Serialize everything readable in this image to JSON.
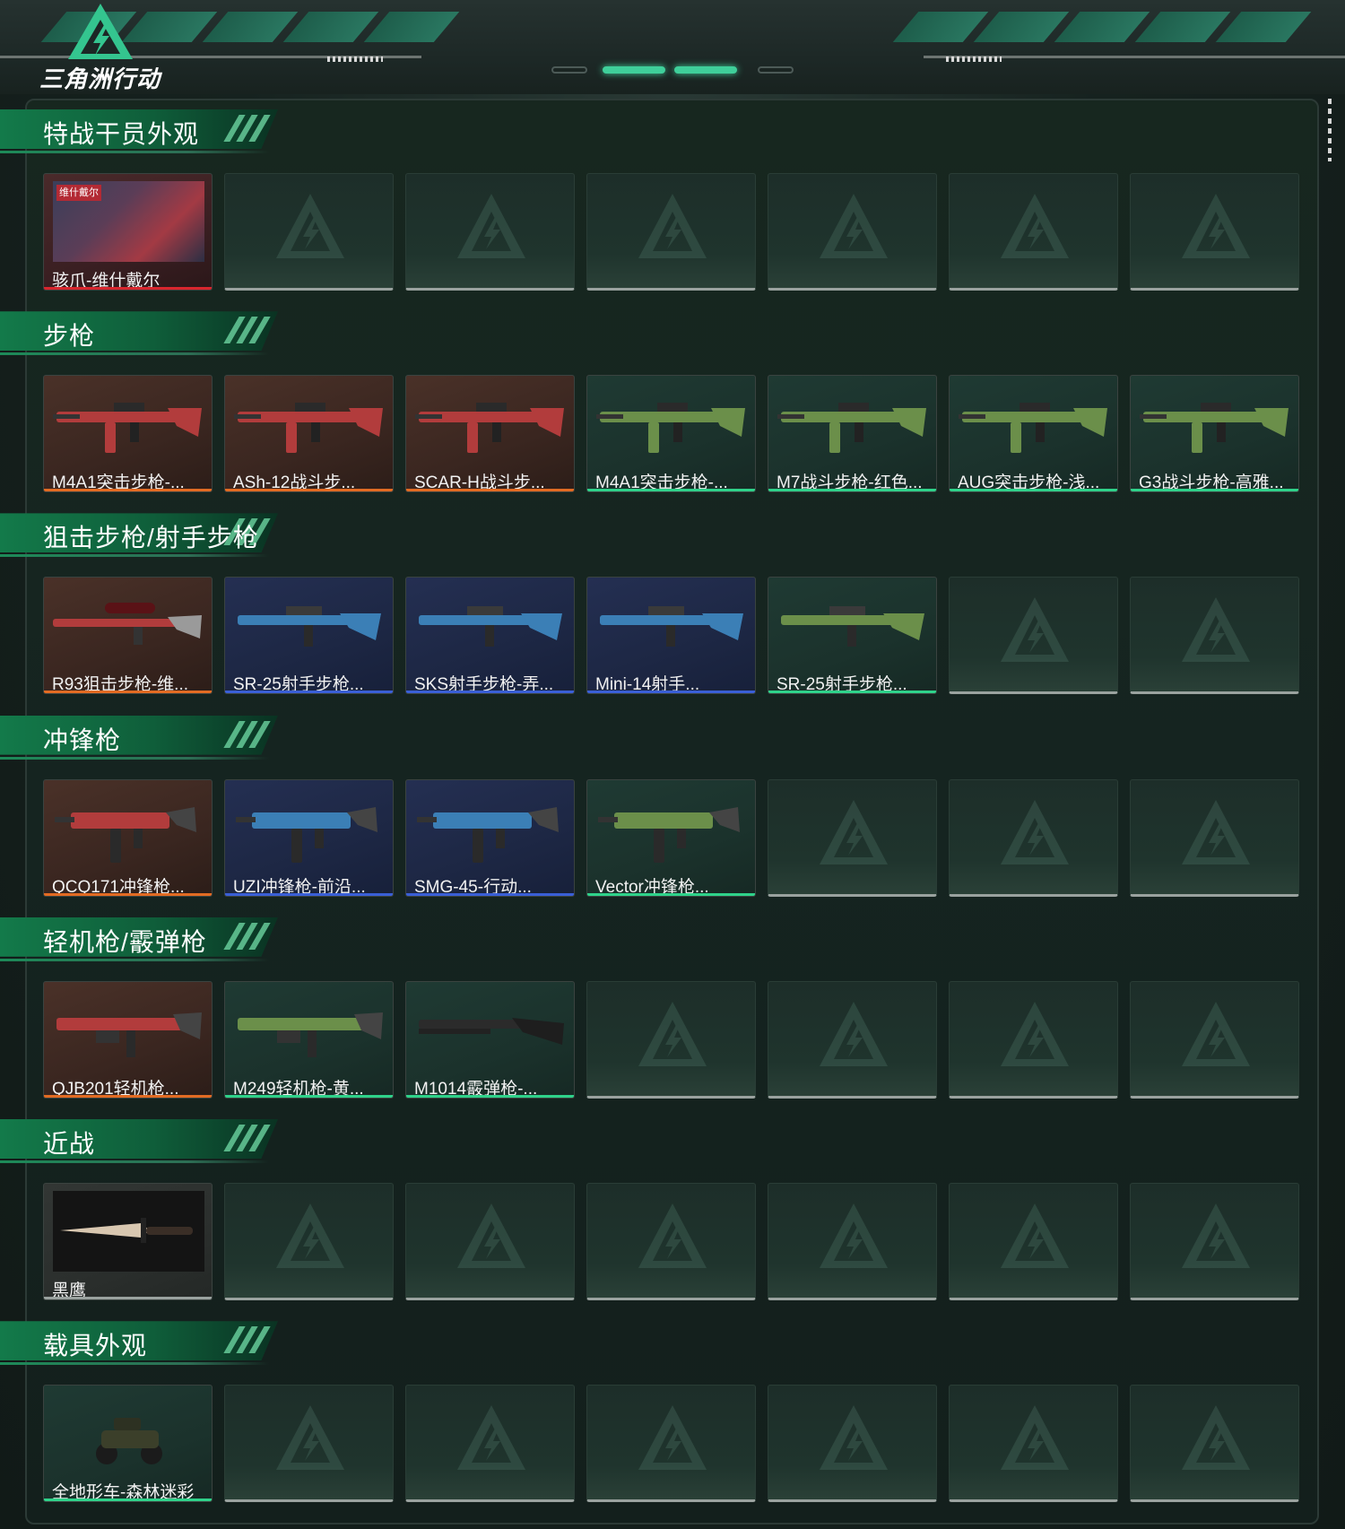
{
  "header": {
    "logo_text": "三角洲行动",
    "logo_icon": "delta-triangle-logo-icon"
  },
  "colors": {
    "accent": "#3fcf9a",
    "section_green": "#137a4a",
    "rarity_orange": "#e26b23",
    "rarity_blue": "#3a5fd6",
    "rarity_green": "#2fd28a",
    "rarity_red": "#d8262e",
    "empty_bar": "#9aa29f"
  },
  "sections": [
    {
      "title": "特战干员外观",
      "items": [
        {
          "label": "骇爪-维什戴尔",
          "image_tag": "维什戴尔",
          "icon": "operator-portrait-icon",
          "rarity": "red",
          "theme": "red"
        }
      ]
    },
    {
      "title": "步枪",
      "items": [
        {
          "label": "M4A1突击步枪-...",
          "icon": "rifle-icon",
          "rarity": "orange",
          "theme": "brown"
        },
        {
          "label": "ASh-12战斗步...",
          "icon": "rifle-icon",
          "rarity": "orange",
          "theme": "brown"
        },
        {
          "label": "SCAR-H战斗步...",
          "icon": "rifle-icon",
          "rarity": "orange",
          "theme": "brown"
        },
        {
          "label": "M4A1突击步枪-...",
          "icon": "rifle-icon",
          "rarity": "green",
          "theme": "green"
        },
        {
          "label": "M7战斗步枪-红色...",
          "icon": "rifle-icon",
          "rarity": "green",
          "theme": "green"
        },
        {
          "label": "AUG突击步枪-浅...",
          "icon": "rifle-icon",
          "rarity": "green",
          "theme": "green"
        },
        {
          "label": "G3战斗步枪-高雅...",
          "icon": "rifle-icon",
          "rarity": "green",
          "theme": "green"
        }
      ]
    },
    {
      "title": "狙击步枪/射手步枪",
      "items": [
        {
          "label": "R93狙击步枪-维...",
          "icon": "sniper-rifle-icon",
          "rarity": "orange",
          "theme": "brown"
        },
        {
          "label": "SR-25射手步枪...",
          "icon": "marksman-rifle-icon",
          "rarity": "blue",
          "theme": "blue"
        },
        {
          "label": "SKS射手步枪-弄...",
          "icon": "marksman-rifle-icon",
          "rarity": "blue",
          "theme": "blue"
        },
        {
          "label": "Mini-14射手...",
          "icon": "marksman-rifle-icon",
          "rarity": "blue",
          "theme": "blue"
        },
        {
          "label": "SR-25射手步枪...",
          "icon": "marksman-rifle-icon",
          "rarity": "green",
          "theme": "green"
        }
      ]
    },
    {
      "title": "冲锋枪",
      "items": [
        {
          "label": "QCQ171冲锋枪...",
          "icon": "smg-icon",
          "rarity": "orange",
          "theme": "brown"
        },
        {
          "label": "UZI冲锋枪-前沿...",
          "icon": "smg-icon",
          "rarity": "blue",
          "theme": "blue"
        },
        {
          "label": "SMG-45-行动...",
          "icon": "smg-icon",
          "rarity": "blue",
          "theme": "blue"
        },
        {
          "label": "Vector冲锋枪...",
          "icon": "smg-icon",
          "rarity": "green",
          "theme": "green"
        }
      ]
    },
    {
      "title": "轻机枪/霰弹枪",
      "items": [
        {
          "label": "QJB201轻机枪...",
          "icon": "lmg-icon",
          "rarity": "orange",
          "theme": "brown"
        },
        {
          "label": "M249轻机枪-黄...",
          "icon": "lmg-icon",
          "rarity": "green",
          "theme": "green"
        },
        {
          "label": "M1014霰弹枪-...",
          "icon": "shotgun-icon",
          "rarity": "green",
          "theme": "green"
        }
      ]
    },
    {
      "title": "近战",
      "items": [
        {
          "label": "黑鹰",
          "icon": "knife-icon",
          "rarity": "gray",
          "theme": "gray"
        }
      ]
    },
    {
      "title": "载具外观",
      "items": [
        {
          "label": "全地形车-森林迷彩",
          "icon": "atv-vehicle-icon",
          "rarity": "green",
          "theme": "green"
        }
      ]
    }
  ],
  "slots_per_row": 7
}
